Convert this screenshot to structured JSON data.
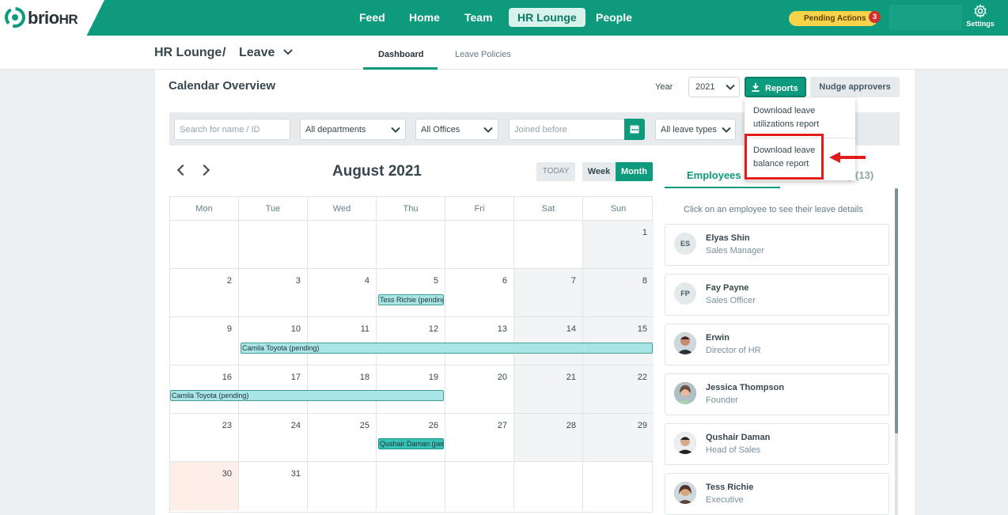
{
  "brand": {
    "name_a": "brio",
    "name_b": "HR"
  },
  "nav": [
    "Feed",
    "Home",
    "Team",
    "HR Lounge",
    "People"
  ],
  "pending": {
    "label": "Pending Actions",
    "count": "3"
  },
  "settings_label": "Settings",
  "breadcrumb": {
    "section": "HR Lounge",
    "separator": "/",
    "page": "Leave"
  },
  "subtabs": [
    "Dashboard",
    "Leave Policies"
  ],
  "overview": {
    "title": "Calendar Overview",
    "year_label": "Year",
    "year_value": "2021",
    "reports_label": "Reports",
    "nudge_label": "Nudge approvers"
  },
  "filters": {
    "search_placeholder": "Search for name / ID",
    "departments": "All departments",
    "offices": "All Offices",
    "joined_placeholder": "Joined before",
    "leave_types": "All leave types"
  },
  "reports_menu": [
    {
      "line1": "Download leave",
      "line2": "utilizations report"
    },
    {
      "line1": "Download leave",
      "line2": "balance report"
    }
  ],
  "calendar": {
    "month_title": "August 2021",
    "today_label": "TODAY",
    "week_label": "Week",
    "month_label": "Month",
    "days": [
      "Mon",
      "Tue",
      "Wed",
      "Thu",
      "Fri",
      "Sat",
      "Sun"
    ],
    "weeks": [
      [
        "",
        "",
        "",
        "",
        "",
        "",
        "1"
      ],
      [
        "2",
        "3",
        "4",
        "5",
        "6",
        "7",
        "8"
      ],
      [
        "9",
        "10",
        "11",
        "12",
        "13",
        "14",
        "15"
      ],
      [
        "16",
        "17",
        "18",
        "19",
        "20",
        "21",
        "22"
      ],
      [
        "23",
        "24",
        "25",
        "26",
        "27",
        "28",
        "29"
      ],
      [
        "30",
        "31",
        "",
        "",
        "",
        "",
        ""
      ]
    ],
    "events": [
      "Tess Richie (pending)",
      "Camila Toyota (pending)",
      "Camila Toyota (pending)",
      "Qushair Daman (pending)"
    ]
  },
  "panel": {
    "employees_tab": "Employees (1",
    "onleave_tab": "ding (13)",
    "hint": "Click on an employee to see their leave details",
    "employees": [
      {
        "initials": "ES",
        "name": "Elyas Shin",
        "role": "Sales Manager"
      },
      {
        "initials": "FP",
        "name": "Fay Payne",
        "role": "Sales Officer"
      },
      {
        "initials": "",
        "name": "Erwin",
        "role": "Director of HR"
      },
      {
        "initials": "",
        "name": "Jessica Thompson",
        "role": "Founder"
      },
      {
        "initials": "",
        "name": "Qushair Daman",
        "role": "Head of Sales"
      },
      {
        "initials": "",
        "name": "Tess Richie",
        "role": "Executive"
      }
    ]
  },
  "colors": {
    "brand": "#0e9a7c",
    "pending": "#f7d34a",
    "highlight": "#e21b1b",
    "event": "#a8e6e6"
  }
}
